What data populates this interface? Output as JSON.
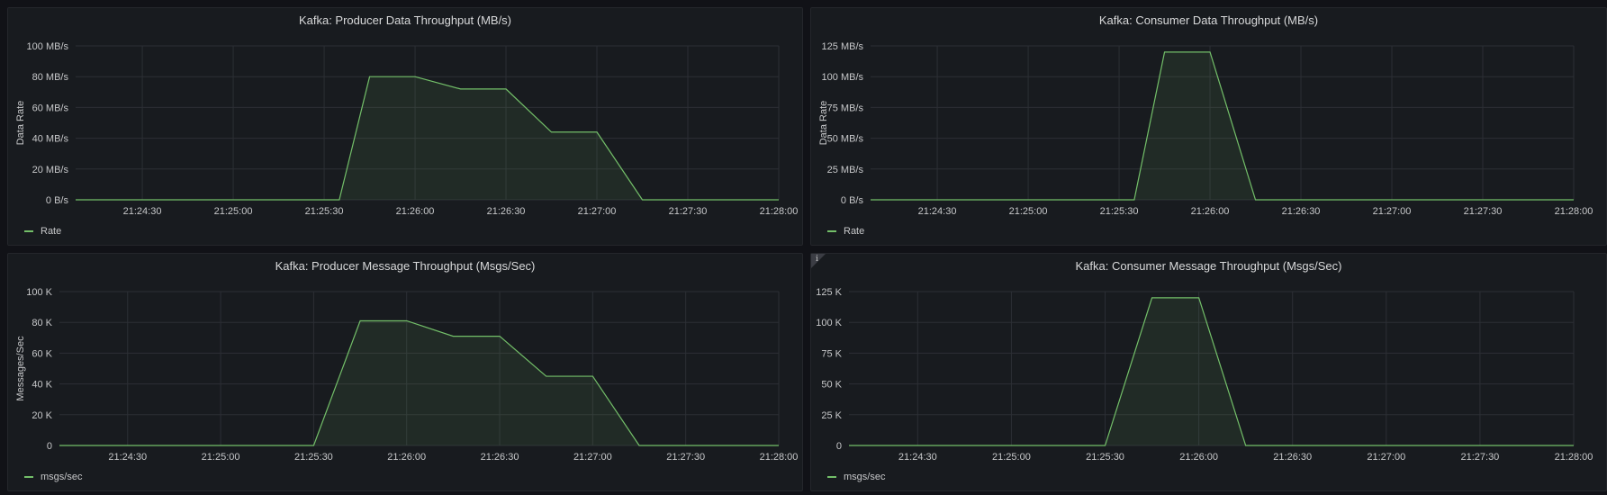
{
  "chart_data": [
    {
      "type": "area",
      "title": "Kafka: Producer Data Throughput (MB/s)",
      "ylabel": "Data Rate",
      "ylim": [
        0,
        100
      ],
      "yticks": [
        0,
        20,
        40,
        60,
        80,
        100
      ],
      "ytick_labels": [
        "0 B/s",
        "20 MB/s",
        "40 MB/s",
        "60 MB/s",
        "80 MB/s",
        "100 MB/s"
      ],
      "xlim": [
        "21:24:08",
        "21:28:00"
      ],
      "xticks": [
        "21:24:30",
        "21:25:00",
        "21:25:30",
        "21:26:00",
        "21:26:30",
        "21:27:00",
        "21:27:30",
        "21:28:00"
      ],
      "legend_position": "bottom-left",
      "grid": true,
      "series": [
        {
          "name": "Rate",
          "color": "#73bf69",
          "x": [
            "21:24:08",
            "21:25:35",
            "21:25:45",
            "21:26:00",
            "21:26:15",
            "21:26:30",
            "21:26:45",
            "21:27:00",
            "21:27:15",
            "21:28:00"
          ],
          "values": [
            0,
            0,
            80,
            80,
            72,
            72,
            44,
            44,
            0,
            0
          ]
        }
      ]
    },
    {
      "type": "area",
      "title": "Kafka: Consumer Data Throughput (MB/s)",
      "ylabel": "Data Rate",
      "ylim": [
        0,
        125
      ],
      "yticks": [
        0,
        25,
        50,
        75,
        100,
        125
      ],
      "ytick_labels": [
        "0 B/s",
        "25 MB/s",
        "50 MB/s",
        "75 MB/s",
        "100 MB/s",
        "125 MB/s"
      ],
      "xlim": [
        "21:24:08",
        "21:28:00"
      ],
      "xticks": [
        "21:24:30",
        "21:25:00",
        "21:25:30",
        "21:26:00",
        "21:26:30",
        "21:27:00",
        "21:27:30",
        "21:28:00"
      ],
      "legend_position": "bottom-left",
      "grid": true,
      "series": [
        {
          "name": "Rate",
          "color": "#73bf69",
          "x": [
            "21:24:08",
            "21:25:35",
            "21:25:45",
            "21:26:00",
            "21:26:15",
            "21:28:00"
          ],
          "values": [
            0,
            0,
            120,
            120,
            0,
            0
          ]
        }
      ]
    },
    {
      "type": "area",
      "title": "Kafka: Producer Message Throughput (Msgs/Sec)",
      "ylabel": "Messages/Sec",
      "ylim": [
        0,
        100
      ],
      "yticks": [
        0,
        20,
        40,
        60,
        80,
        100
      ],
      "ytick_labels": [
        "0",
        "20 K",
        "40 K",
        "60 K",
        "80 K",
        "100 K"
      ],
      "xlim": [
        "21:24:08",
        "21:28:00"
      ],
      "xticks": [
        "21:24:30",
        "21:25:00",
        "21:25:30",
        "21:26:00",
        "21:26:30",
        "21:27:00",
        "21:27:30",
        "21:28:00"
      ],
      "legend_position": "bottom-left",
      "grid": true,
      "series": [
        {
          "name": "msgs/sec",
          "color": "#73bf69",
          "x": [
            "21:24:08",
            "21:25:30",
            "21:25:45",
            "21:26:00",
            "21:26:15",
            "21:26:30",
            "21:26:45",
            "21:27:00",
            "21:27:15",
            "21:28:00"
          ],
          "values": [
            0,
            0,
            81,
            81,
            71,
            71,
            45,
            45,
            0,
            0
          ]
        }
      ]
    },
    {
      "type": "area",
      "title": "Kafka: Consumer Message Throughput (Msgs/Sec)",
      "ylabel": "",
      "ylim": [
        0,
        125
      ],
      "yticks": [
        0,
        25,
        50,
        75,
        100,
        125
      ],
      "ytick_labels": [
        "0",
        "25 K",
        "50 K",
        "75 K",
        "100 K",
        "125 K"
      ],
      "xlim": [
        "21:24:08",
        "21:28:00"
      ],
      "xticks": [
        "21:24:30",
        "21:25:00",
        "21:25:30",
        "21:26:00",
        "21:26:30",
        "21:27:00",
        "21:27:30",
        "21:28:00"
      ],
      "legend_position": "bottom-left",
      "grid": true,
      "info_marker": "i",
      "series": [
        {
          "name": "msgs/sec",
          "color": "#73bf69",
          "x": [
            "21:24:08",
            "21:25:30",
            "21:25:45",
            "21:26:00",
            "21:26:15",
            "21:28:00"
          ],
          "values": [
            0,
            0,
            120,
            120,
            0,
            0
          ]
        }
      ]
    }
  ]
}
